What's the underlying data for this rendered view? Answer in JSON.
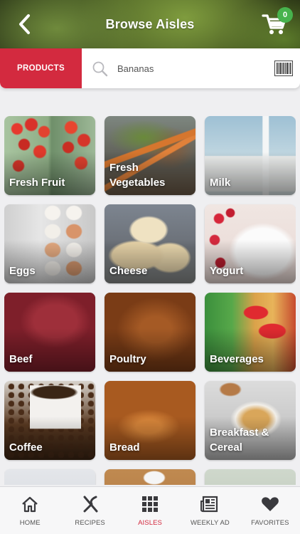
{
  "header": {
    "title": "Browse Aisles",
    "cart_count": "0",
    "back_icon": "chevron-left-icon",
    "cart_icon": "shopping-cart-icon"
  },
  "search": {
    "tab_label": "PRODUCTS",
    "value": "Bananas",
    "placeholder": "Bananas",
    "search_icon": "magnifier-icon",
    "barcode_icon": "barcode-icon"
  },
  "aisles": [
    {
      "label": "Fresh Fruit"
    },
    {
      "label": "Fresh\nVegetables"
    },
    {
      "label": "Milk"
    },
    {
      "label": "Eggs"
    },
    {
      "label": "Cheese"
    },
    {
      "label": "Yogurt"
    },
    {
      "label": "Beef"
    },
    {
      "label": "Poultry"
    },
    {
      "label": "Beverages"
    },
    {
      "label": "Coffee"
    },
    {
      "label": "Bread"
    },
    {
      "label": "Breakfast &\nCereal"
    }
  ],
  "tabbar": {
    "items": [
      {
        "label": "HOME",
        "icon": "home-icon"
      },
      {
        "label": "RECIPES",
        "icon": "utensils-icon"
      },
      {
        "label": "AISLES",
        "icon": "grid-icon"
      },
      {
        "label": "WEEKLY AD",
        "icon": "newspaper-icon"
      },
      {
        "label": "FAVORITES",
        "icon": "heart-icon"
      }
    ],
    "active": "AISLES"
  },
  "colors": {
    "accent": "#d32a3f",
    "badge": "#47b34d",
    "background": "#efeff1"
  }
}
